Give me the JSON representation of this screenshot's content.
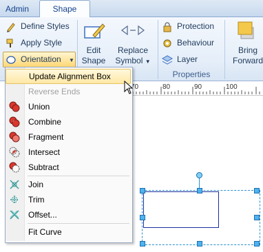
{
  "tabs": [
    {
      "label": "Admin",
      "active": false
    },
    {
      "label": "Shape",
      "active": true
    }
  ],
  "ribbon": {
    "define_styles": "Define Styles",
    "apply_style": "Apply Style",
    "orientation": "Orientation",
    "edit_shape_line1": "Edit",
    "edit_shape_line2": "Shape",
    "replace_symbol_line1": "Replace",
    "replace_symbol_line2": "Symbol",
    "protection": "Protection",
    "behaviour": "Behaviour",
    "layer": "Layer",
    "properties_group": "Properties",
    "bring_forward_line1": "Bring",
    "bring_forward_line2": "Forward"
  },
  "ruler": {
    "ticks": [
      "70",
      "80",
      "90",
      "100"
    ]
  },
  "menu": {
    "items": [
      {
        "label": "Update Alignment Box",
        "icon": "none",
        "state": "highlighted"
      },
      {
        "label": "Reverse Ends",
        "icon": "none",
        "state": "disabled"
      },
      {
        "label": "Union",
        "icon": "union-icon",
        "state": "normal"
      },
      {
        "label": "Combine",
        "icon": "combine-icon",
        "state": "normal"
      },
      {
        "label": "Fragment",
        "icon": "fragment-icon",
        "state": "normal"
      },
      {
        "label": "Intersect",
        "icon": "intersect-icon",
        "state": "normal"
      },
      {
        "label": "Subtract",
        "icon": "subtract-icon",
        "state": "normal"
      },
      {
        "label": "Join",
        "icon": "join-icon",
        "state": "normal"
      },
      {
        "label": "Trim",
        "icon": "trim-icon",
        "state": "normal"
      },
      {
        "label": "Offset...",
        "icon": "offset-icon",
        "state": "normal"
      },
      {
        "label": "Fit Curve",
        "icon": "none",
        "state": "normal"
      }
    ]
  },
  "colors": {
    "accent_red": "#d9382e",
    "highlight": "#ffe8a6",
    "selection": "#2a8fd0",
    "shape_stroke": "#1a2f9e"
  }
}
